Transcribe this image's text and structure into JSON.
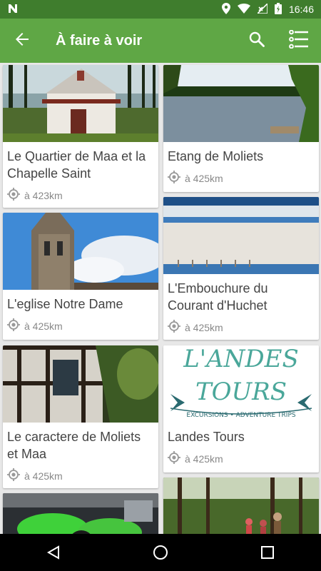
{
  "status_bar": {
    "time": "16:46"
  },
  "app_bar": {
    "title": "À faire à voir"
  },
  "cards": [
    {
      "title": "Le Quartier de Maa et la Chapelle Saint",
      "distance": "à 423km"
    },
    {
      "title": "Etang de Moliets",
      "distance": "à 425km"
    },
    {
      "title": "L'eglise Notre Dame",
      "distance": "à 425km"
    },
    {
      "title": "L'Embouchure du Courant d'Huchet",
      "distance": "à 425km"
    },
    {
      "title": "Le caractere de Moliets et Maa",
      "distance": "à 425km"
    },
    {
      "title": "Landes Tours",
      "distance": "à 425km"
    },
    {
      "title": "",
      "distance": ""
    },
    {
      "title": "",
      "distance": ""
    }
  ],
  "landes_logo": {
    "line1": "L'ANDES",
    "line2": "TOURS",
    "line3": "EXCURSIONS • ADVENTURE TRIPS"
  }
}
